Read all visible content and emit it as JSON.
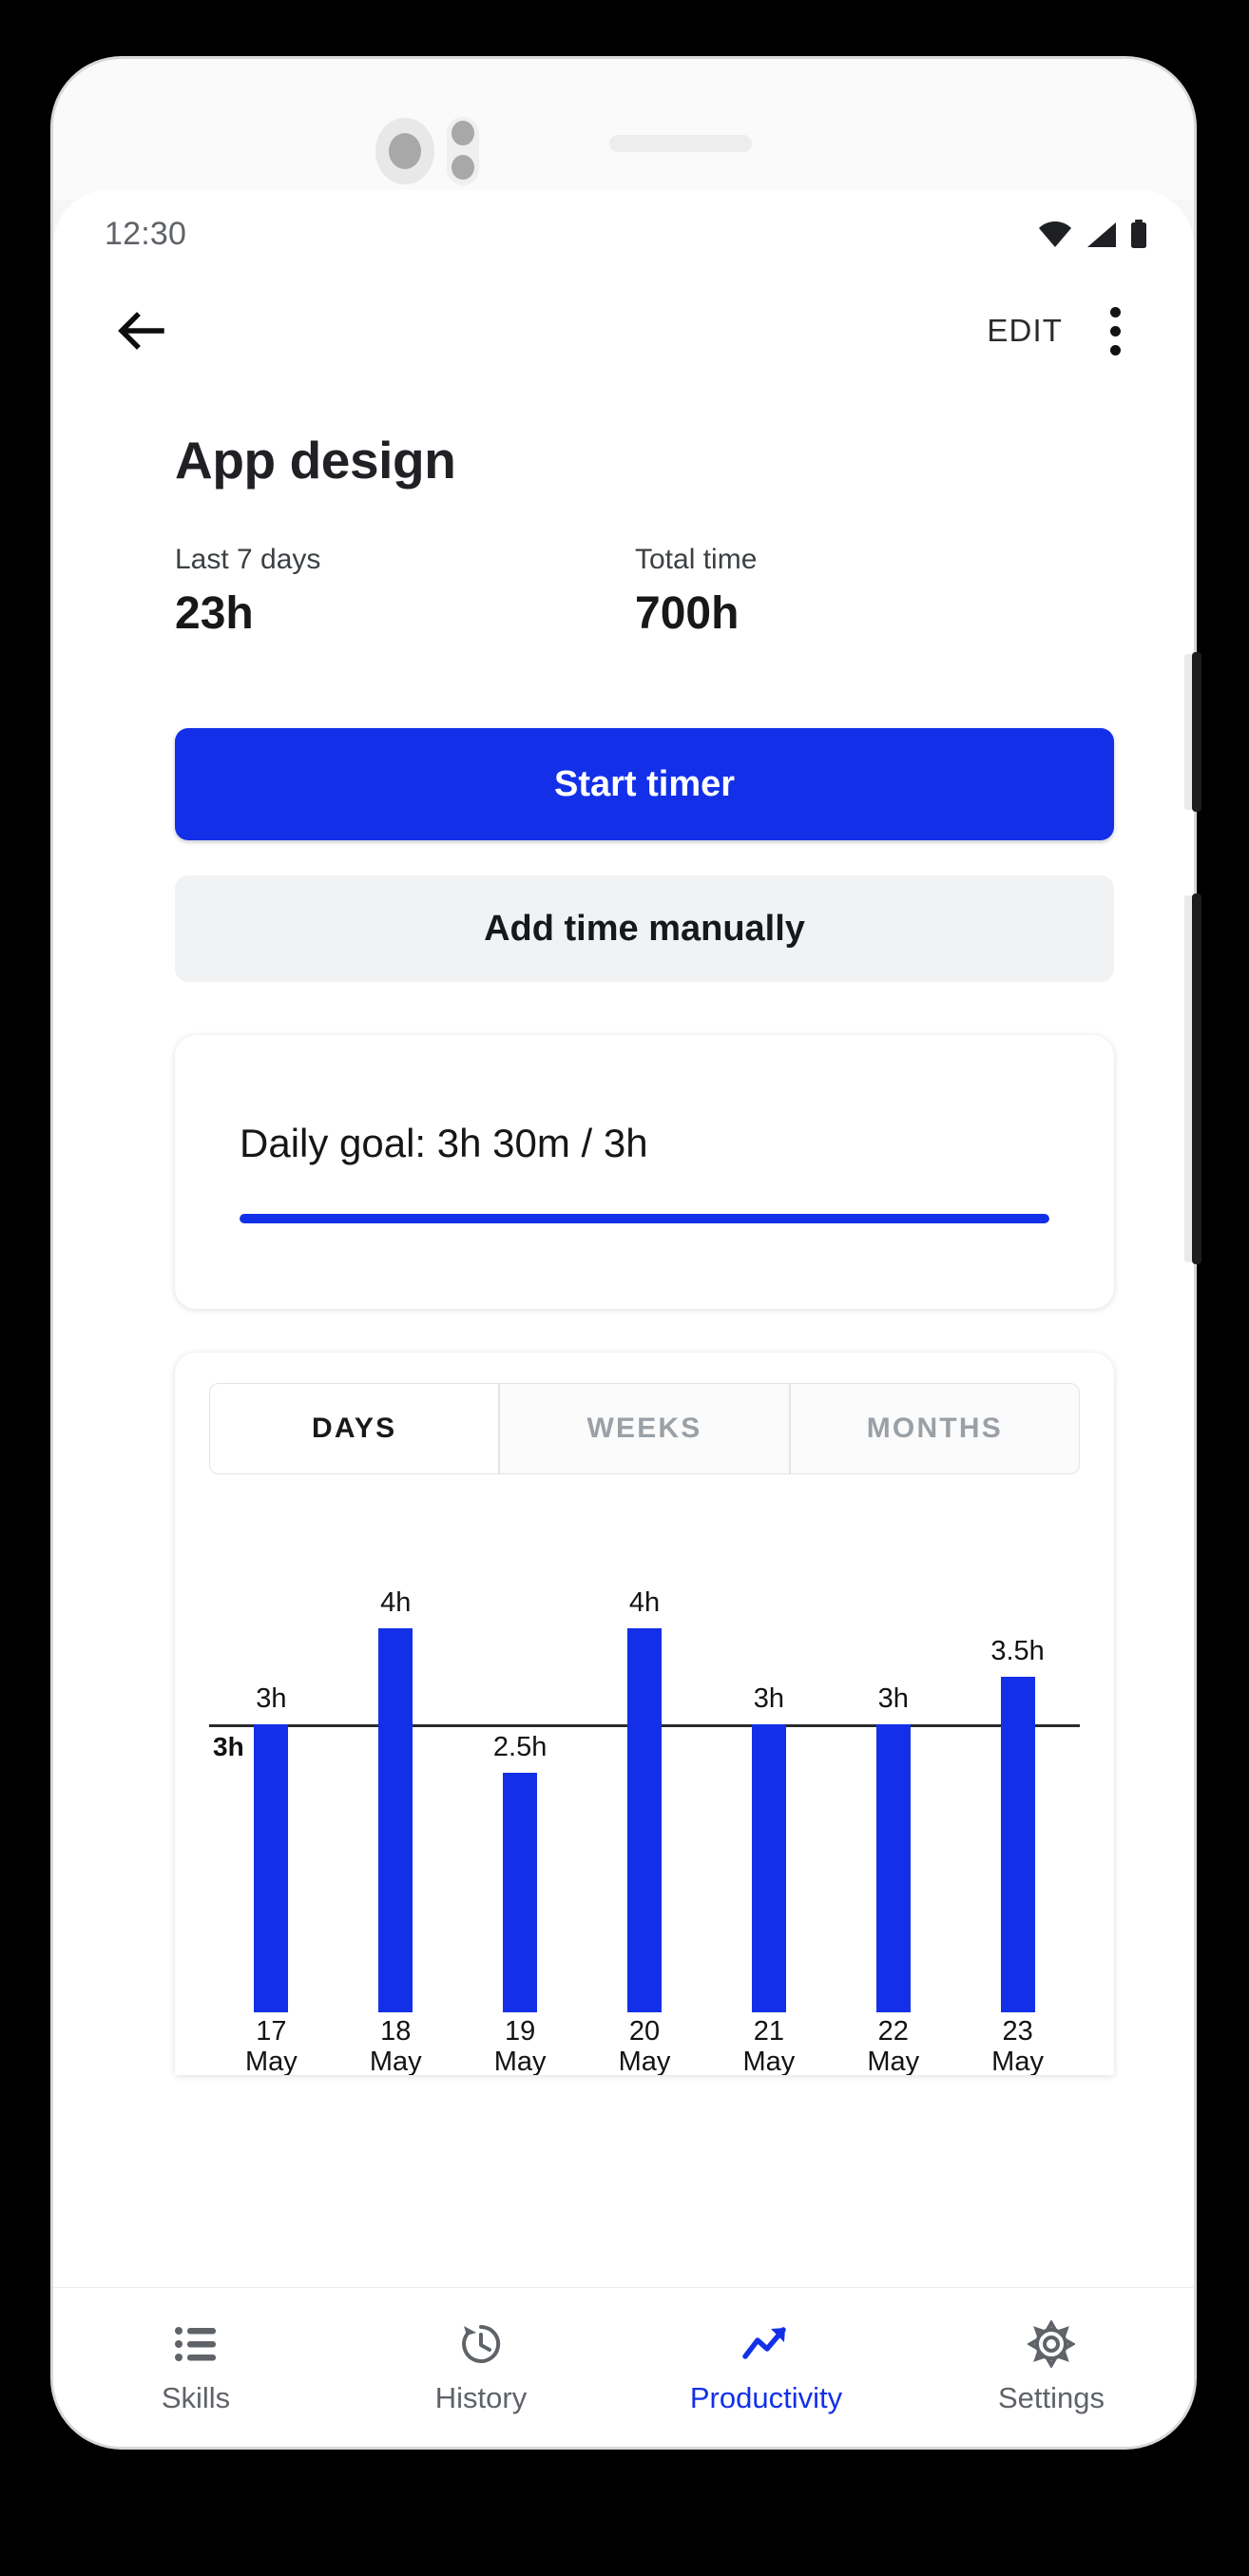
{
  "status_bar": {
    "time": "12:30",
    "icons": [
      "wifi-icon",
      "signal-icon",
      "battery-icon"
    ]
  },
  "app_bar": {
    "back_icon": "arrow-left-icon",
    "edit_label": "EDIT",
    "overflow_icon": "more-vertical-icon"
  },
  "header": {
    "title": "App design"
  },
  "stats": [
    {
      "label": "Last 7 days",
      "value": "23h"
    },
    {
      "label": "Total time",
      "value": "700h"
    }
  ],
  "actions": {
    "start_timer_label": "Start timer",
    "add_time_label": "Add time manually"
  },
  "daily_goal": {
    "text": "Daily goal: 3h 30m / 3h",
    "progress_percent": 100,
    "bar_color": "#1330e8"
  },
  "chart_tabs": [
    {
      "label": "DAYS",
      "active": true
    },
    {
      "label": "WEEKS",
      "active": false
    },
    {
      "label": "MONTHS",
      "active": false
    }
  ],
  "chart_data": {
    "type": "bar",
    "title": "",
    "xlabel": "",
    "ylabel": "",
    "categories": [
      "17 May",
      "18 May",
      "19 May",
      "20 May",
      "21 May",
      "22 May",
      "23 May"
    ],
    "tick_lines": [
      [
        "17",
        "May"
      ],
      [
        "18",
        "May"
      ],
      [
        "19",
        "May"
      ],
      [
        "20",
        "May"
      ],
      [
        "21",
        "May"
      ],
      [
        "22",
        "May"
      ],
      [
        "23",
        "May"
      ]
    ],
    "values": [
      3,
      4,
      2.5,
      4,
      3,
      3,
      3.5
    ],
    "value_labels": [
      "3h",
      "4h",
      "2.5h",
      "4h",
      "3h",
      "3h",
      "3.5h"
    ],
    "ylim": [
      0,
      4
    ],
    "goal_line_value": 3,
    "goal_line_label": "3h",
    "bar_color": "#1330e8",
    "grid": false,
    "legend": "none"
  },
  "bottom_nav": [
    {
      "label": "Skills",
      "icon": "list-icon",
      "active": false
    },
    {
      "label": "History",
      "icon": "history-clock-icon",
      "active": false
    },
    {
      "label": "Productivity",
      "icon": "trending-up-icon",
      "active": true
    },
    {
      "label": "Settings",
      "icon": "gear-icon",
      "active": false
    }
  ],
  "colors": {
    "accent": "#1330e8",
    "text_primary": "#18191a",
    "text_secondary": "#5f6368"
  }
}
